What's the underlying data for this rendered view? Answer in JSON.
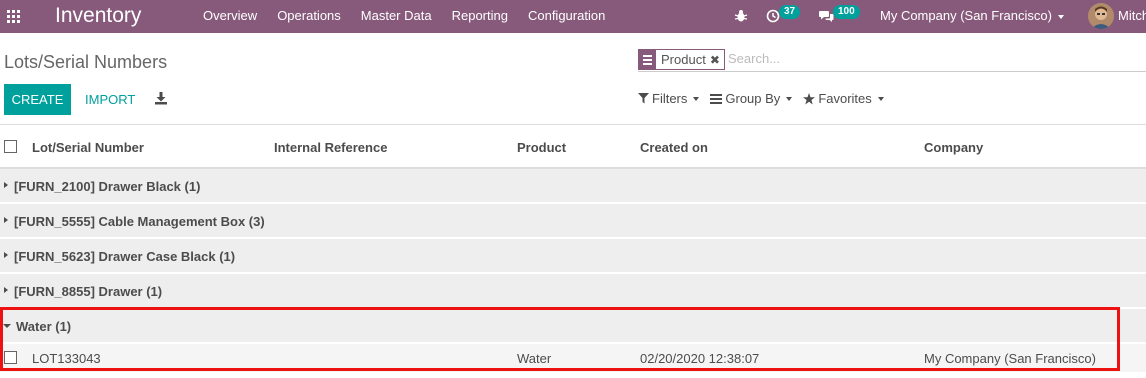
{
  "navbar": {
    "app_title": "Inventory",
    "menu": [
      "Overview",
      "Operations",
      "Master Data",
      "Reporting",
      "Configuration"
    ],
    "activity_count": "37",
    "message_count": "100",
    "company": "My Company (San Francisco)",
    "user": "Mitch",
    "icons": {
      "apps": "apps-grid-icon",
      "debug": "bug-icon",
      "activity": "clock-icon",
      "messages": "chat-bubbles-icon"
    }
  },
  "control_panel": {
    "breadcrumb": "Lots/Serial Numbers",
    "search": {
      "facet_label": "Product",
      "facet_remove": "✖",
      "placeholder": "Search..."
    },
    "buttons": {
      "create": "CREATE",
      "import": "IMPORT"
    },
    "options": {
      "filters": "Filters",
      "group_by": "Group By",
      "favorites": "Favorites"
    }
  },
  "list": {
    "columns": [
      "Lot/Serial Number",
      "Internal Reference",
      "Product",
      "Created on",
      "Company"
    ],
    "groups": [
      {
        "label": "[FURN_2100] Drawer Black (1)",
        "expanded": false
      },
      {
        "label": "[FURN_5555] Cable Management Box (3)",
        "expanded": false
      },
      {
        "label": "[FURN_5623] Drawer Case Black (1)",
        "expanded": false
      },
      {
        "label": "[FURN_8855] Drawer (1)",
        "expanded": false
      },
      {
        "label": "Water (1)",
        "expanded": true
      }
    ],
    "rows": [
      {
        "lot": "LOT133043",
        "internal_reference": "",
        "product": "Water",
        "created_on": "02/20/2020 12:38:07",
        "company": "My Company (San Francisco)"
      }
    ]
  },
  "colors": {
    "navbar": "#875a7b",
    "primary": "#00a09d",
    "badge": "#00a09d",
    "highlight": "#ee1111"
  }
}
